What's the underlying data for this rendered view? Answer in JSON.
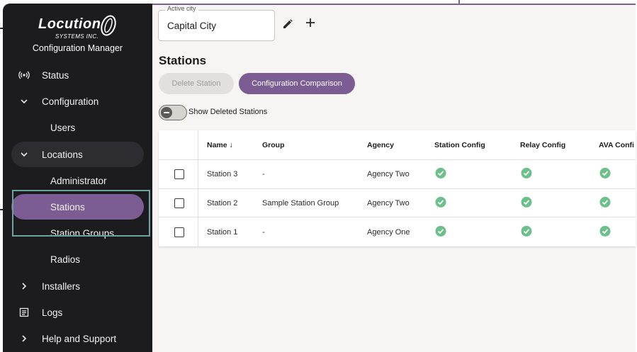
{
  "brand": {
    "logo_word": "Locution",
    "logo_sub": "SYSTEMS INC.",
    "app_title": "Configuration Manager"
  },
  "sidebar": {
    "items": [
      {
        "label": "Status",
        "icon": "broadcast-icon"
      },
      {
        "label": "Configuration",
        "icon": "chevron-down-icon"
      },
      {
        "label": "Users"
      },
      {
        "label": "Locations",
        "icon": "chevron-down-icon"
      },
      {
        "label": "Administrator"
      },
      {
        "label": "Stations"
      },
      {
        "label": "Station Groups"
      },
      {
        "label": "Radios"
      },
      {
        "label": "Installers",
        "icon": "chevron-right-icon"
      },
      {
        "label": "Logs",
        "icon": "document-icon"
      },
      {
        "label": "Help and Support",
        "icon": "chevron-right-icon"
      }
    ],
    "active": "Stations"
  },
  "city": {
    "legend": "Active city",
    "value": "Capital City"
  },
  "page": {
    "title": "Stations",
    "delete_label": "Delete Station",
    "compare_label": "Configuration Comparison",
    "toggle_label": "Show Deleted Stations"
  },
  "table": {
    "headers": {
      "name": "Name",
      "group": "Group",
      "agency": "Agency",
      "station_config": "Station Config",
      "relay_config": "Relay Config",
      "ava_config": "AVA Confi"
    },
    "rows": [
      {
        "name": "Station 3",
        "group": "-",
        "agency": "Agency Two"
      },
      {
        "name": "Station 2",
        "group": "Sample Station Group",
        "agency": "Agency Two"
      },
      {
        "name": "Station 1",
        "group": "-",
        "agency": "Agency One"
      }
    ]
  },
  "colors": {
    "accent": "#7b5c93",
    "sidebar_bg": "#1c1c1e",
    "check_green": "#6dbf8c",
    "highlight": "#6aa39f"
  }
}
